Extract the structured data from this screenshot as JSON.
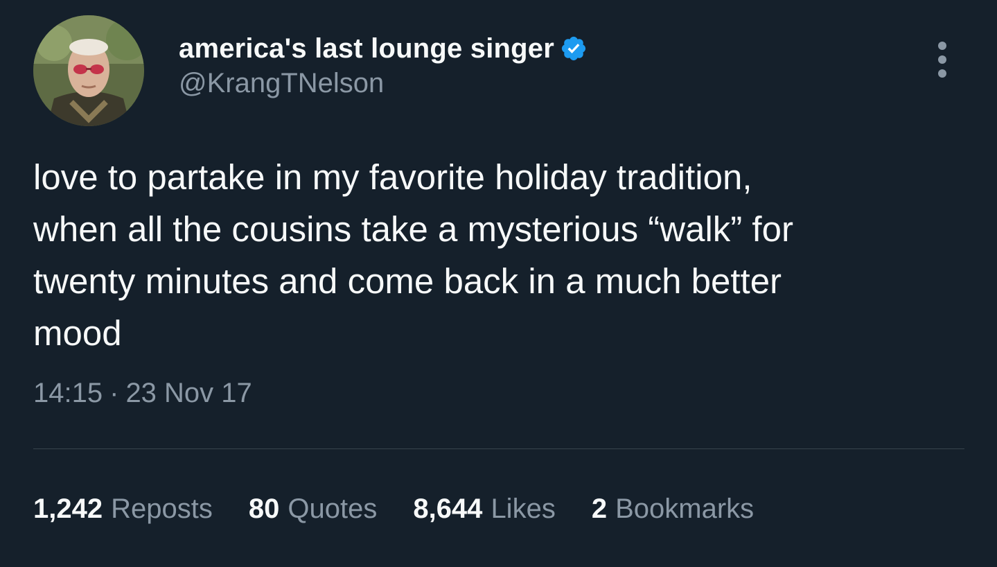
{
  "tweet": {
    "author": {
      "display_name": "america's last lounge singer",
      "handle": "@KrangTNelson",
      "verified": true
    },
    "text": "love to partake in my favorite holiday tradition,\nwhen all the cousins take a mysterious “walk” for\ntwenty minutes and come back in a much better\nmood",
    "time": "14:15",
    "separator": "·",
    "date": "23 Nov 17",
    "stats": [
      {
        "count": "1,242",
        "label": "Reposts"
      },
      {
        "count": "80",
        "label": "Quotes"
      },
      {
        "count": "8,644",
        "label": "Likes"
      },
      {
        "count": "2",
        "label": "Bookmarks"
      }
    ]
  },
  "icons": {
    "verified": "verified-badge-icon",
    "more": "more-options-icon"
  },
  "colors": {
    "background": "#15202b",
    "primary_text": "#f7f9f9",
    "secondary_text": "#8b98a5",
    "verified_blue": "#1d9bf0",
    "divider": "#38444d"
  }
}
